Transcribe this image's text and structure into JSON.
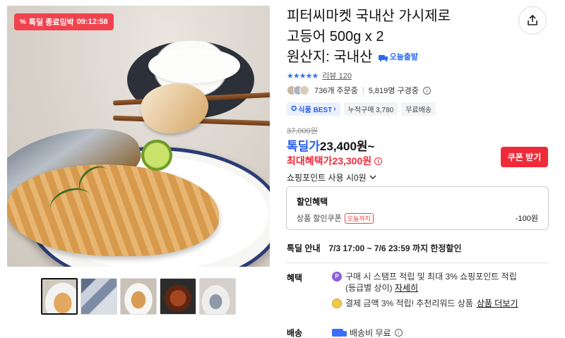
{
  "badge": {
    "icon": "percent-icon",
    "label": "톡딜 종료임박",
    "timer": "09:12:58"
  },
  "product": {
    "title_line1": "피터씨마켓 국내산 가시제로",
    "title_line2": "고등어 500g x 2",
    "title_line3": "원산지: 국내산",
    "today_ship": "오늘출발"
  },
  "rating": {
    "stars": "★★★★★",
    "review": "리뷰 120"
  },
  "orders": {
    "count": "736개 주문중",
    "subscribers": "5,819명 구경중"
  },
  "tags": [
    {
      "label": "식품 BEST",
      "icon": "shield-icon",
      "chevron": "›"
    },
    {
      "label": "누적구매 3,780"
    },
    {
      "label": "무료배송"
    }
  ],
  "price": {
    "original": "37,000원",
    "deal_label": "톡딜가",
    "deal_value": "23,400원~",
    "max_label": "최대혜택가",
    "max_value": "23,300원",
    "coupon_button": "쿠폰 받기",
    "points": "쇼핑포인트 사용 시0원"
  },
  "discount": {
    "header": "할인혜택",
    "item_label": "상품 할인쿠폰",
    "item_chip": "오늘까지",
    "item_amount": "-100원"
  },
  "deal_notice": {
    "label": "톡딜 안내",
    "value": "7/3 17:00 ~ 7/6 23:59 까지 한정할인"
  },
  "benefits": {
    "label": "혜택",
    "line1": "구매 시 스탬프 적립 및 최대 3% 쇼핑포인트 적립",
    "line2": "(등급별 상이)",
    "line2_link": "자세히",
    "line3": "결제 금액 3% 적립! 추천리워드 상품",
    "line3_link": "상품 더보기"
  },
  "shipping": {
    "label": "배송",
    "value": "배송비 무료"
  },
  "colors": {
    "accent_red": "#ef2b3a",
    "accent_blue": "#2a5ee6",
    "badge_red": "#f0434e"
  }
}
